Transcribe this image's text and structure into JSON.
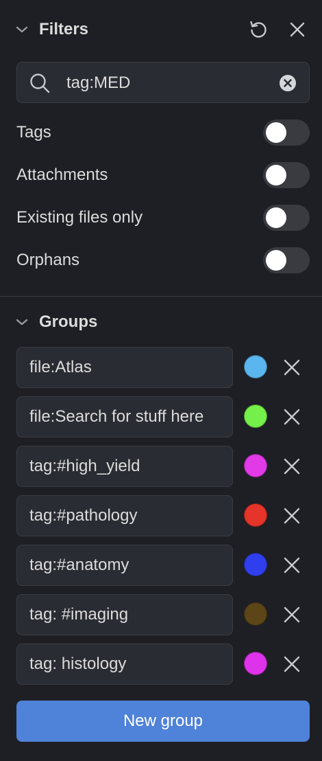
{
  "filters": {
    "title": "Filters",
    "search": {
      "value": "tag:MED",
      "placeholder": ""
    },
    "toggles": [
      {
        "label": "Tags",
        "enabled": false
      },
      {
        "label": "Attachments",
        "enabled": false
      },
      {
        "label": "Existing files only",
        "enabled": false
      },
      {
        "label": "Orphans",
        "enabled": false
      }
    ]
  },
  "groups": {
    "title": "Groups",
    "items": [
      {
        "query": "file:Atlas",
        "color": "#5bb5ee"
      },
      {
        "query": "file:Search for stuff here",
        "color": "#75f04a"
      },
      {
        "query": "tag:#high_yield",
        "color": "#e23ae6"
      },
      {
        "query": "tag:#pathology",
        "color": "#e5342a"
      },
      {
        "query": "tag:#anatomy",
        "color": "#2f3fee"
      },
      {
        "query": "tag: #imaging",
        "color": "#5e4517"
      },
      {
        "query": "tag: histology",
        "color": "#de33ea"
      }
    ],
    "new_group_label": "New group"
  },
  "icons": {
    "collapse": "chevron-down-icon",
    "reset": "restore-icon",
    "close": "close-icon",
    "search": "search-icon",
    "clear": "clear-circle-icon",
    "remove": "close-icon"
  }
}
